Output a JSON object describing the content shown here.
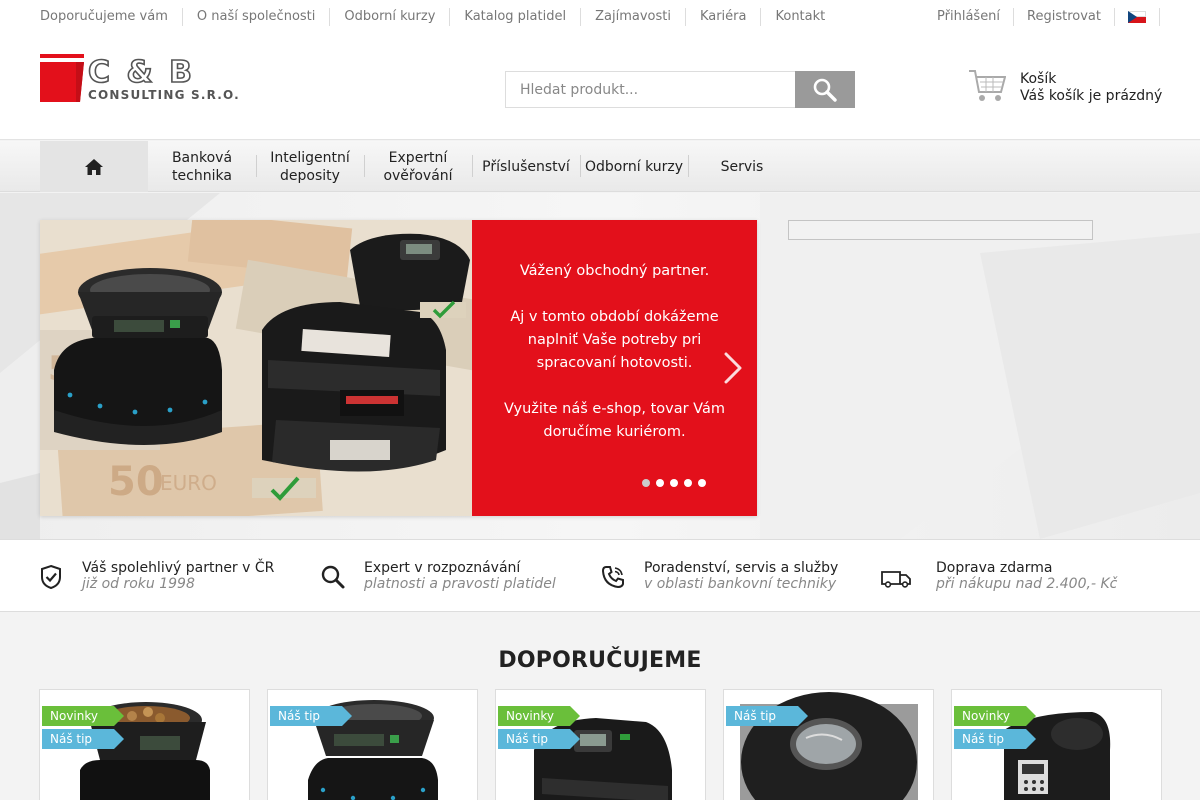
{
  "topnav": {
    "items": [
      "Doporučujeme vám",
      "O naší společnosti",
      "Odborní kurzy",
      "Katalog platidel",
      "Zajímavosti",
      "Kariéra",
      "Kontakt"
    ]
  },
  "user": {
    "login": "Přihlášení",
    "register": "Registrovat",
    "language_flag": "cz-flag-icon"
  },
  "logo": {
    "name": "C & B",
    "subtitle": "CONSULTING s.r.o."
  },
  "search": {
    "placeholder": "Hledat produkt...",
    "value": ""
  },
  "cart": {
    "title": "Košík",
    "status": "Váš košík je prázdný"
  },
  "mainnav": {
    "items": [
      {
        "label": "Banková technika"
      },
      {
        "label": "Inteligentní deposity"
      },
      {
        "label": "Expertní ověřování"
      },
      {
        "label": "Příslušenství"
      },
      {
        "label": "Odborní kurzy"
      },
      {
        "label": "Servis"
      }
    ]
  },
  "slider": {
    "lines": [
      "Vážený obchodný partner.",
      "Aj v tomto období dokážeme naplniť Vaše potreby pri spracovaní hotovosti.",
      "Využite náš e-shop, tovar Vám doručíme kuriérom."
    ],
    "dots_count": 5,
    "active_dot": 0
  },
  "features": [
    {
      "title": "Váš spolehlivý partner v ČR",
      "subtitle": "již od roku 1998",
      "icon": "shield-check-icon"
    },
    {
      "title": "Expert v rozpoznávání",
      "subtitle": "platnosti a pravosti platidel",
      "icon": "magnifier-icon"
    },
    {
      "title": "Poradenství, servis a služby",
      "subtitle": "v oblasti bankovní techniky",
      "icon": "phone-icon"
    },
    {
      "title": "Doprava zdarma",
      "subtitle": "při nákupu nad 2.400,- Kč",
      "icon": "van-icon"
    }
  ],
  "recommended": {
    "title": "DOPORUČUJEME",
    "products": [
      {
        "badges": [
          "Novinky",
          "Náš tip"
        ]
      },
      {
        "badges": [
          "Náš tip"
        ]
      },
      {
        "badges": [
          "Novinky",
          "Náš tip"
        ]
      },
      {
        "badges": [
          "Náš tip"
        ]
      },
      {
        "badges": [
          "Novinky",
          "Náš tip"
        ]
      }
    ]
  },
  "colors": {
    "brand_red": "#e3101b",
    "badge_green": "#6abf3a",
    "badge_blue": "#5bb7da",
    "search_button": "#9a9a9a"
  }
}
